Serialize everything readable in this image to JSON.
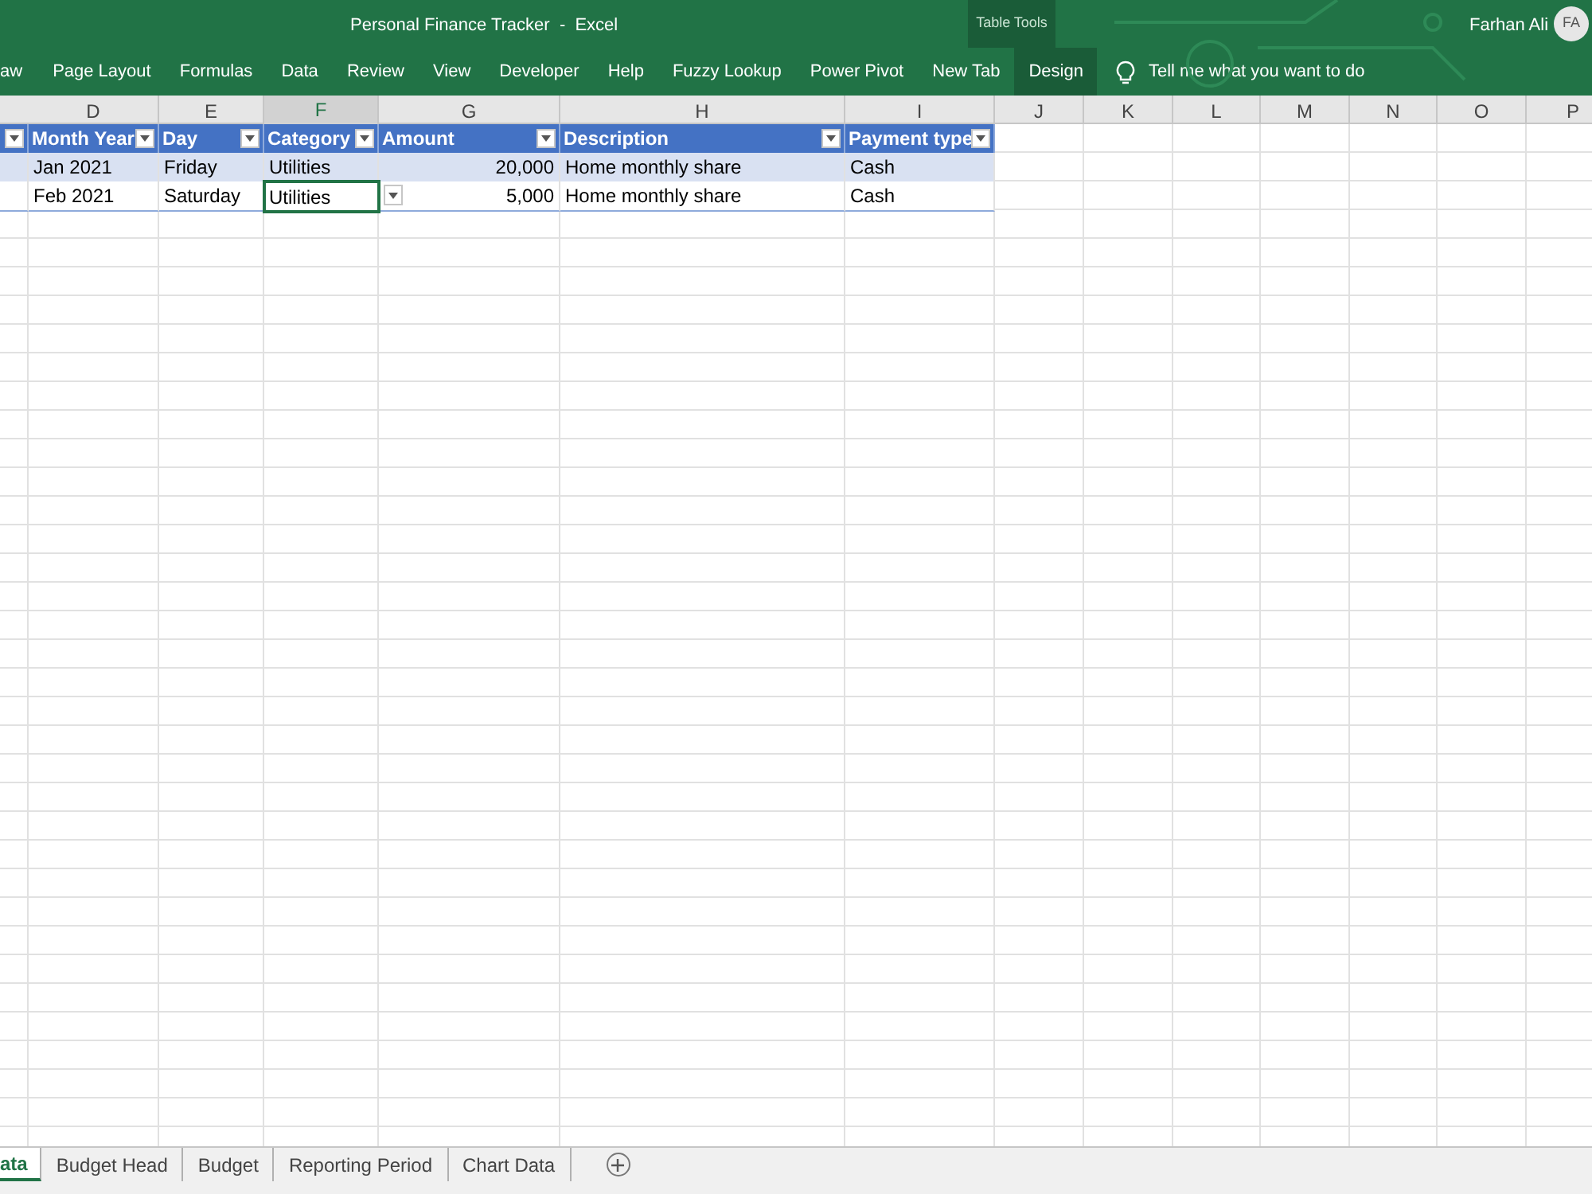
{
  "window": {
    "title": "Personal Finance Tracker  -  Excel",
    "context_label": "Table Tools",
    "user": "Farhan Ali",
    "avatar": "FA"
  },
  "ribbon_tabs": [
    {
      "label": "aw",
      "selected": false
    },
    {
      "label": "Page Layout",
      "selected": false
    },
    {
      "label": "Formulas",
      "selected": false
    },
    {
      "label": "Data",
      "selected": false
    },
    {
      "label": "Review",
      "selected": false
    },
    {
      "label": "View",
      "selected": false
    },
    {
      "label": "Developer",
      "selected": false
    },
    {
      "label": "Help",
      "selected": false
    },
    {
      "label": "Fuzzy Lookup",
      "selected": false
    },
    {
      "label": "Power Pivot",
      "selected": false
    },
    {
      "label": "New Tab",
      "selected": false
    },
    {
      "label": "Design",
      "selected": true
    }
  ],
  "tell_me": {
    "placeholder": "Tell me what you want to do"
  },
  "columns": [
    {
      "label": "D",
      "selected": false
    },
    {
      "label": "E",
      "selected": false
    },
    {
      "label": "F",
      "selected": true
    },
    {
      "label": "G",
      "selected": false
    },
    {
      "label": "H",
      "selected": false
    },
    {
      "label": "I",
      "selected": false
    },
    {
      "label": "J",
      "selected": false
    },
    {
      "label": "K",
      "selected": false
    },
    {
      "label": "L",
      "selected": false
    },
    {
      "label": "M",
      "selected": false
    },
    {
      "label": "N",
      "selected": false
    },
    {
      "label": "O",
      "selected": false
    },
    {
      "label": "P",
      "selected": false
    }
  ],
  "table": {
    "headers": [
      {
        "label": "Month Year",
        "kind": "text"
      },
      {
        "label": "Day",
        "kind": "text"
      },
      {
        "label": "Category",
        "kind": "text"
      },
      {
        "label": "Amount",
        "kind": "number"
      },
      {
        "label": "Description",
        "kind": "text"
      },
      {
        "label": "Payment type",
        "kind": "text"
      }
    ],
    "rows": [
      {
        "banded": true,
        "cells": [
          {
            "text": "Jan 2021",
            "selected": false
          },
          {
            "text": "Friday",
            "selected": false
          },
          {
            "text": "Utilities",
            "selected": false
          },
          {
            "text": "20,000",
            "selected": false
          },
          {
            "text": "Home monthly share",
            "selected": false
          },
          {
            "text": "Cash",
            "selected": false
          }
        ]
      },
      {
        "banded": false,
        "cells": [
          {
            "text": "Feb 2021",
            "selected": false
          },
          {
            "text": "Saturday",
            "selected": false
          },
          {
            "text": "Utilities",
            "selected": true
          },
          {
            "text": "5,000",
            "selected": false
          },
          {
            "text": "Home monthly share",
            "selected": false
          },
          {
            "text": "Cash",
            "selected": false
          }
        ]
      }
    ]
  },
  "sheet_tabs": [
    {
      "label": "ata",
      "selected": true
    },
    {
      "label": "Budget Head",
      "selected": false
    },
    {
      "label": "Budget",
      "selected": false
    },
    {
      "label": "Reporting Period",
      "selected": false
    },
    {
      "label": "Chart Data",
      "selected": false
    }
  ]
}
